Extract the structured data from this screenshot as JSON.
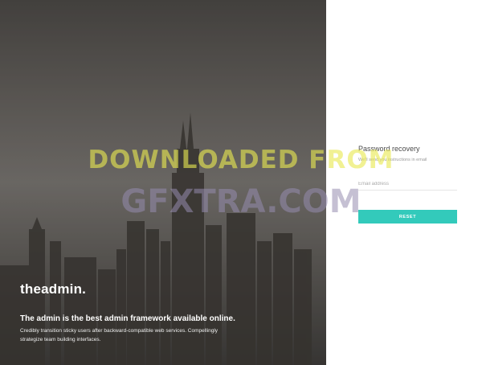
{
  "hero": {
    "brand": "theadmin.",
    "tagline": "The admin is the best admin framework available online.",
    "description": "Credibly transition sticky users after backward-compatible web services. Compellingly strategize team building interfaces."
  },
  "recovery": {
    "title": "Password recovery",
    "subtitle": "We'll send you instructions in email",
    "email_placeholder": "Email address",
    "reset_label": "RESET"
  },
  "watermark": {
    "line1": "DOWNLOADED FROM",
    "line2": "GFXTRA.COM"
  },
  "colors": {
    "accent": "#33cabb"
  }
}
